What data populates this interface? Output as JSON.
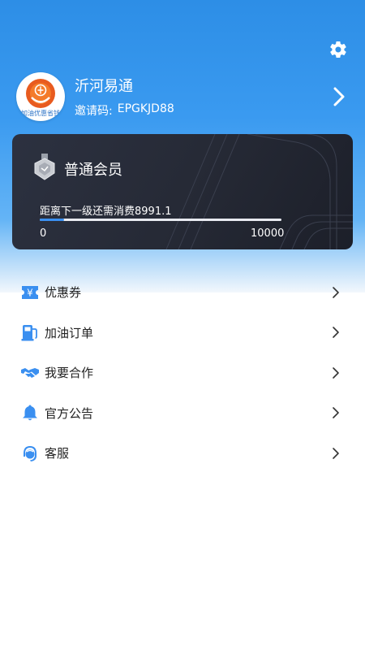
{
  "profile": {
    "name": "沂河易通",
    "invite_label": "邀请码:",
    "invite_code": "EPGKJD88",
    "avatar_caption": "加油优惠省钱"
  },
  "membership": {
    "level": "普通会员",
    "progress_text": "距离下一级还需消费8991.1",
    "progress_min": "0",
    "progress_max": "10000",
    "progress_fraction": 0.1
  },
  "menu": {
    "items": [
      {
        "label": "优惠券",
        "icon": "coupon-icon"
      },
      {
        "label": "加油订单",
        "icon": "fuel-pump-icon"
      },
      {
        "label": "我要合作",
        "icon": "handshake-icon"
      },
      {
        "label": "官方公告",
        "icon": "bell-icon"
      },
      {
        "label": "客服",
        "icon": "customer-service-icon"
      }
    ]
  },
  "colors": {
    "header_blue": "#2d8ee6",
    "icon_blue": "#3a8ff0",
    "card_dark": "#262a36"
  }
}
